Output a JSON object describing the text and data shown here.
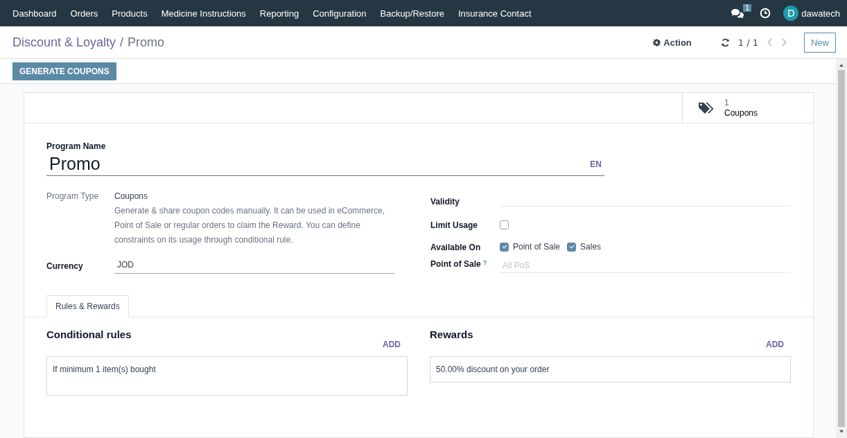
{
  "navbar": {
    "menu": [
      "Dashboard",
      "Orders",
      "Products",
      "Medicine Instructions",
      "Reporting",
      "Configuration",
      "Backup/Restore",
      "Insurance Contact"
    ],
    "message_count": "1",
    "user": {
      "initial": "D",
      "name": "dawatech"
    }
  },
  "control_panel": {
    "breadcrumb": [
      {
        "label": "Discount & Loyalty"
      },
      {
        "label": "Promo"
      }
    ],
    "breadcrumb_separator": "/",
    "action": "Action",
    "pager": "1 / 1",
    "new_button": "New"
  },
  "status_bar": {
    "button": "GENERATE COUPONS"
  },
  "smart_button": {
    "count": "1",
    "label": "Coupons"
  },
  "program_name": {
    "label": "Program Name",
    "value": "Promo",
    "language": "EN"
  },
  "left_fields": {
    "program_type": {
      "label": "Program Type",
      "value": "Coupons",
      "help": "Generate & share coupon codes manually. It can be used in eCommerce, Point of Sale or regular orders to claim the Reward. You can define constraints on its usage through conditional rule."
    },
    "currency": {
      "label": "Currency",
      "value": "JOD"
    }
  },
  "right_fields": {
    "validity": {
      "label": "Validity"
    },
    "limit_usage": {
      "label": "Limit Usage",
      "checked": false
    },
    "available_on": {
      "label": "Available On",
      "options": [
        {
          "label": "Point of Sale",
          "checked": true
        },
        {
          "label": "Sales",
          "checked": true
        }
      ]
    },
    "point_of_sale": {
      "label": "Point of Sale",
      "tooltip_mark": "?",
      "placeholder": "All PoS"
    }
  },
  "tabs": [
    {
      "label": "Rules & Rewards",
      "selected": true
    }
  ],
  "sections": [
    {
      "title": "Conditional rules",
      "add": "ADD",
      "items": [
        "If minimum 1 item(s) bought"
      ],
      "tall": true
    },
    {
      "title": "Rewards",
      "add": "ADD",
      "items": [
        "50.00% discount on your order"
      ],
      "tall": false
    }
  ]
}
